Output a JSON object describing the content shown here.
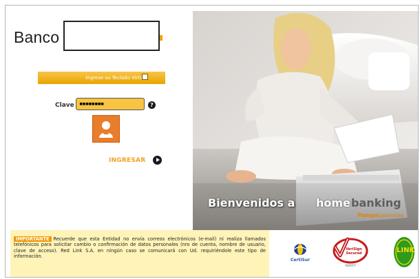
{
  "brand": {
    "name": "Banco"
  },
  "login": {
    "virtual_keyboard_label": "Ingrese su Teclado Virtual",
    "password_label": "Clave",
    "password_value": "▪▪▪▪▪▪▪▪",
    "help_symbol": "?",
    "submit_label": "INGRESAR"
  },
  "hero": {
    "welcome": "Bienvenidos a",
    "home": "home",
    "banking": "banking",
    "brand_line_a": "Pampa",
    "brand_line_b": "personas"
  },
  "notice": {
    "badge": "IMPORTANTE",
    "text": "Recuerde que esta Entidad no envía correos electrónicos (e-mail) ni realiza llamados telefónicos para solicitar cambio o confirmación de datos personales (nro de cuenta, nombre de usuario, clave de acceso). Red Link S.A. en ningún caso se comunicará con Ud. requiriéndole este tipo de información."
  },
  "seals": {
    "certisur": "CertiSur",
    "verisign": "VeriSign Secured",
    "verisign_verify": "VERIFY",
    "link": "LINK"
  },
  "colors": {
    "accent_orange": "#f2a000",
    "notice_bg": "#fff3b8",
    "link_green": "#2e9a1e"
  },
  "icons": [
    "help-icon",
    "user-icon",
    "arrow-right-icon",
    "certisur-logo",
    "verisign-seal",
    "link-logo"
  ]
}
